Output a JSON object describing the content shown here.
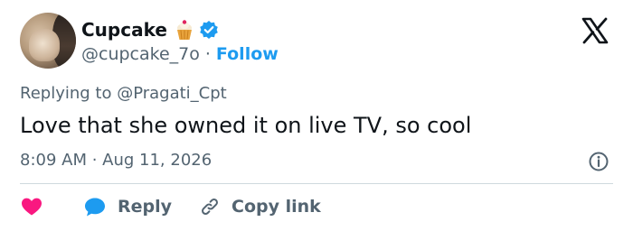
{
  "tweet": {
    "author": {
      "display_name": "Cupcake",
      "handle": "@cupcake_7o",
      "follow_label": "Follow",
      "separator": "·",
      "avatar_icon": "avatar-photo",
      "badge_icon": "verified-badge-icon",
      "emoji_icon": "cupcake-emoji-icon"
    },
    "replying_to": "Replying to @Pragati_Cpt",
    "text": "Love that she owned it on live TV, so cool",
    "timestamp": "8:09 AM · Aug 11, 2026"
  },
  "actions": {
    "like_icon": "heart-icon",
    "reply_label": "Reply",
    "copy_link_label": "Copy link"
  },
  "colors": {
    "accent": "#1d9bf0",
    "like": "#f91880",
    "text": "#0f1419",
    "muted": "#536471",
    "divider": "#cfd9de"
  }
}
